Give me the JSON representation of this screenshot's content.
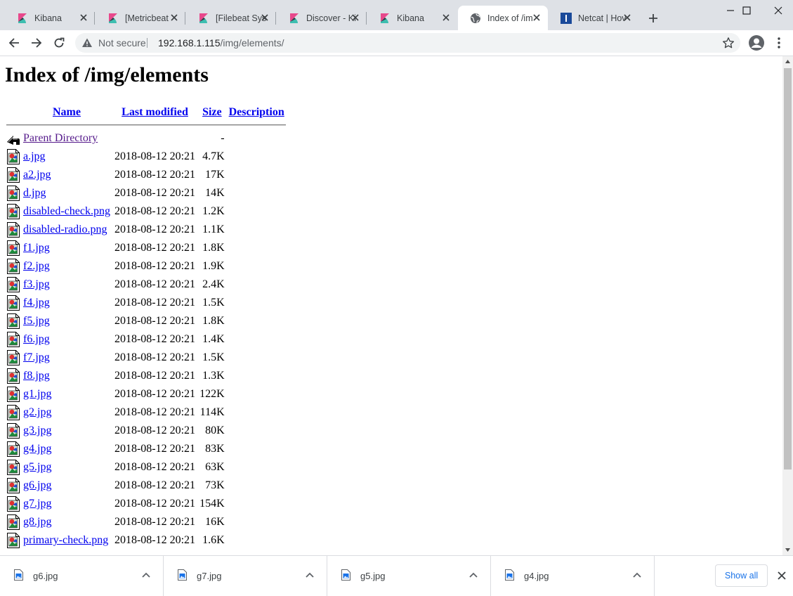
{
  "tabs": [
    {
      "title": "Kibana",
      "icon": "kibana-icon"
    },
    {
      "title": "[Metricbeat",
      "icon": "kibana-icon"
    },
    {
      "title": "[Filebeat Sys",
      "icon": "kibana-icon"
    },
    {
      "title": "Discover - Ki",
      "icon": "kibana-icon"
    },
    {
      "title": "Kibana",
      "icon": "kibana-icon"
    },
    {
      "title": "Index of /im",
      "icon": "globe-icon",
      "active": true
    },
    {
      "title": "Netcat | Hov",
      "icon": "netcat-icon"
    }
  ],
  "toolbar": {
    "security_label": "Not secure",
    "url_host": "192.168.1.115",
    "url_path": "/img/elements/"
  },
  "page": {
    "title": "Index of /img/elements",
    "headers": {
      "name": "Name",
      "modified": "Last modified",
      "size": "Size",
      "description": "Description"
    },
    "parent": {
      "name": "Parent Directory",
      "size": "-"
    },
    "files": [
      {
        "name": "a.jpg",
        "modified": "2018-08-12 20:21",
        "size": "4.7K"
      },
      {
        "name": "a2.jpg",
        "modified": "2018-08-12 20:21",
        "size": "17K"
      },
      {
        "name": "d.jpg",
        "modified": "2018-08-12 20:21",
        "size": "14K"
      },
      {
        "name": "disabled-check.png",
        "modified": "2018-08-12 20:21",
        "size": "1.2K"
      },
      {
        "name": "disabled-radio.png",
        "modified": "2018-08-12 20:21",
        "size": "1.1K"
      },
      {
        "name": "f1.jpg",
        "modified": "2018-08-12 20:21",
        "size": "1.8K"
      },
      {
        "name": "f2.jpg",
        "modified": "2018-08-12 20:21",
        "size": "1.9K"
      },
      {
        "name": "f3.jpg",
        "modified": "2018-08-12 20:21",
        "size": "2.4K"
      },
      {
        "name": "f4.jpg",
        "modified": "2018-08-12 20:21",
        "size": "1.5K"
      },
      {
        "name": "f5.jpg",
        "modified": "2018-08-12 20:21",
        "size": "1.8K"
      },
      {
        "name": "f6.jpg",
        "modified": "2018-08-12 20:21",
        "size": "1.4K"
      },
      {
        "name": "f7.jpg",
        "modified": "2018-08-12 20:21",
        "size": "1.5K"
      },
      {
        "name": "f8.jpg",
        "modified": "2018-08-12 20:21",
        "size": "1.3K"
      },
      {
        "name": "g1.jpg",
        "modified": "2018-08-12 20:21",
        "size": "122K"
      },
      {
        "name": "g2.jpg",
        "modified": "2018-08-12 20:21",
        "size": "114K"
      },
      {
        "name": "g3.jpg",
        "modified": "2018-08-12 20:21",
        "size": "80K"
      },
      {
        "name": "g4.jpg",
        "modified": "2018-08-12 20:21",
        "size": "83K"
      },
      {
        "name": "g5.jpg",
        "modified": "2018-08-12 20:21",
        "size": "63K"
      },
      {
        "name": "g6.jpg",
        "modified": "2018-08-12 20:21",
        "size": "73K"
      },
      {
        "name": "g7.jpg",
        "modified": "2018-08-12 20:21",
        "size": "154K"
      },
      {
        "name": "g8.jpg",
        "modified": "2018-08-12 20:21",
        "size": "16K"
      },
      {
        "name": "primary-check.png",
        "modified": "2018-08-12 20:21",
        "size": "1.6K"
      }
    ]
  },
  "downloads": {
    "items": [
      {
        "name": "g6.jpg"
      },
      {
        "name": "g7.jpg"
      },
      {
        "name": "g5.jpg"
      },
      {
        "name": "g4.jpg"
      }
    ],
    "show_all_label": "Show all"
  },
  "colors": {
    "link": "#0000ee",
    "visited_link": "#551a8b",
    "tabstrip_bg": "#dee1e6",
    "accent": "#1a73e8",
    "kibana_pink": "#e8488b",
    "kibana_teal": "#3ebeb0"
  }
}
